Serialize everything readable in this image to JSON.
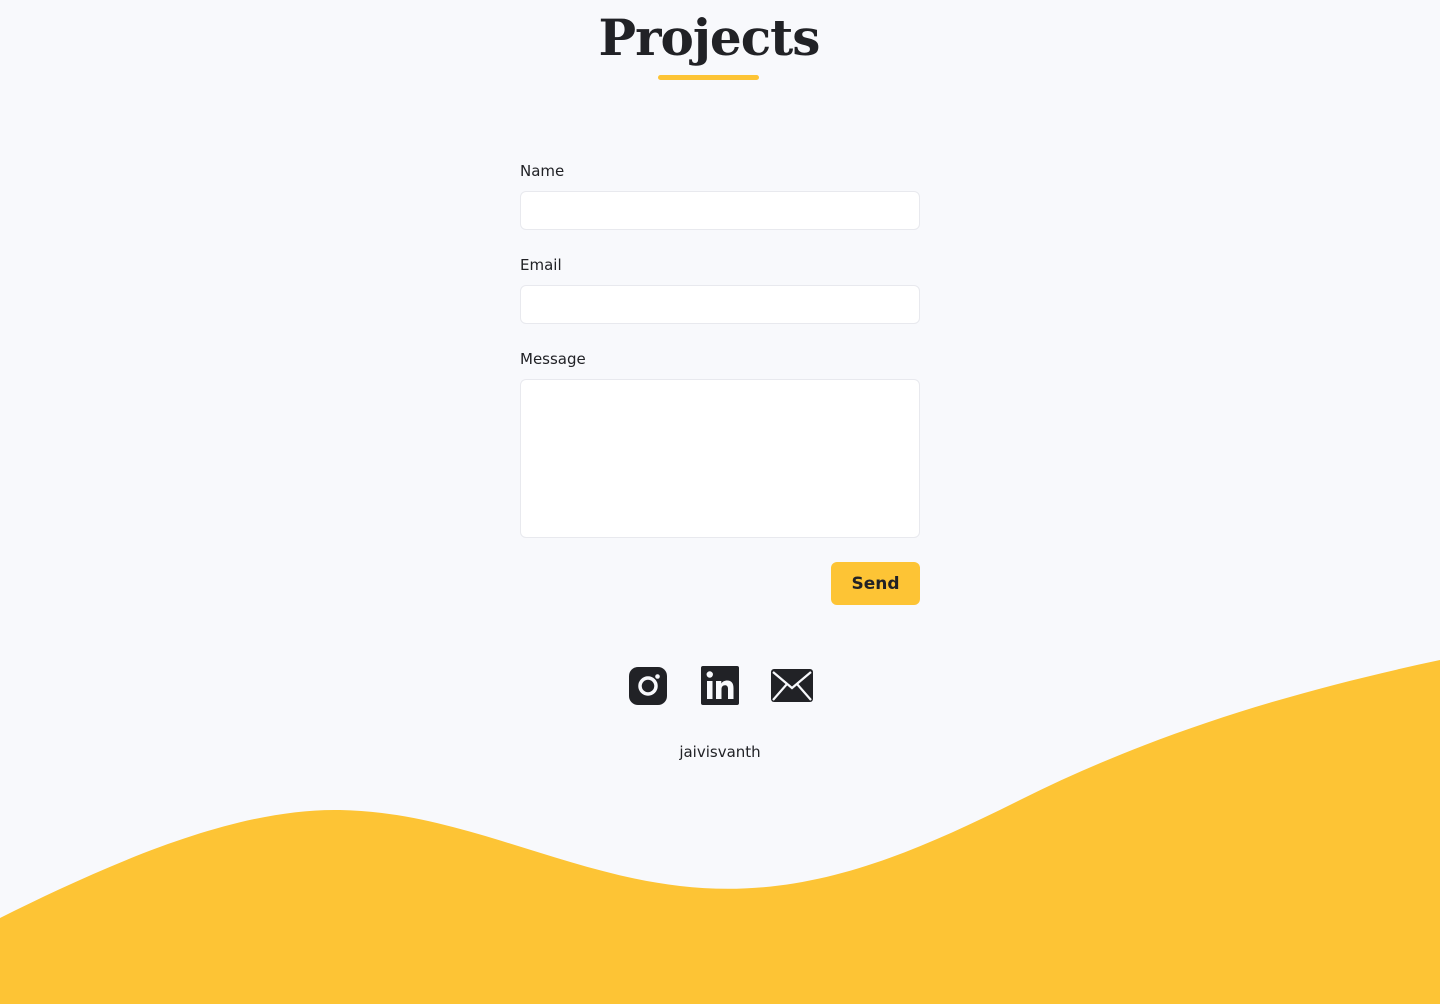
{
  "header": {
    "title": "Projects"
  },
  "contact_form": {
    "name_label": "Name",
    "name_value": "",
    "email_label": "Email",
    "email_value": "",
    "message_label": "Message",
    "message_value": "",
    "send_label": "Send"
  },
  "social_links": [
    {
      "icon": "instagram-icon"
    },
    {
      "icon": "linkedin-icon"
    },
    {
      "icon": "mail-icon"
    }
  ],
  "footer": {
    "handle": "jaivisvanth"
  },
  "colors": {
    "accent": "#fdc435",
    "text": "#212226",
    "background": "#f8f9fc"
  }
}
